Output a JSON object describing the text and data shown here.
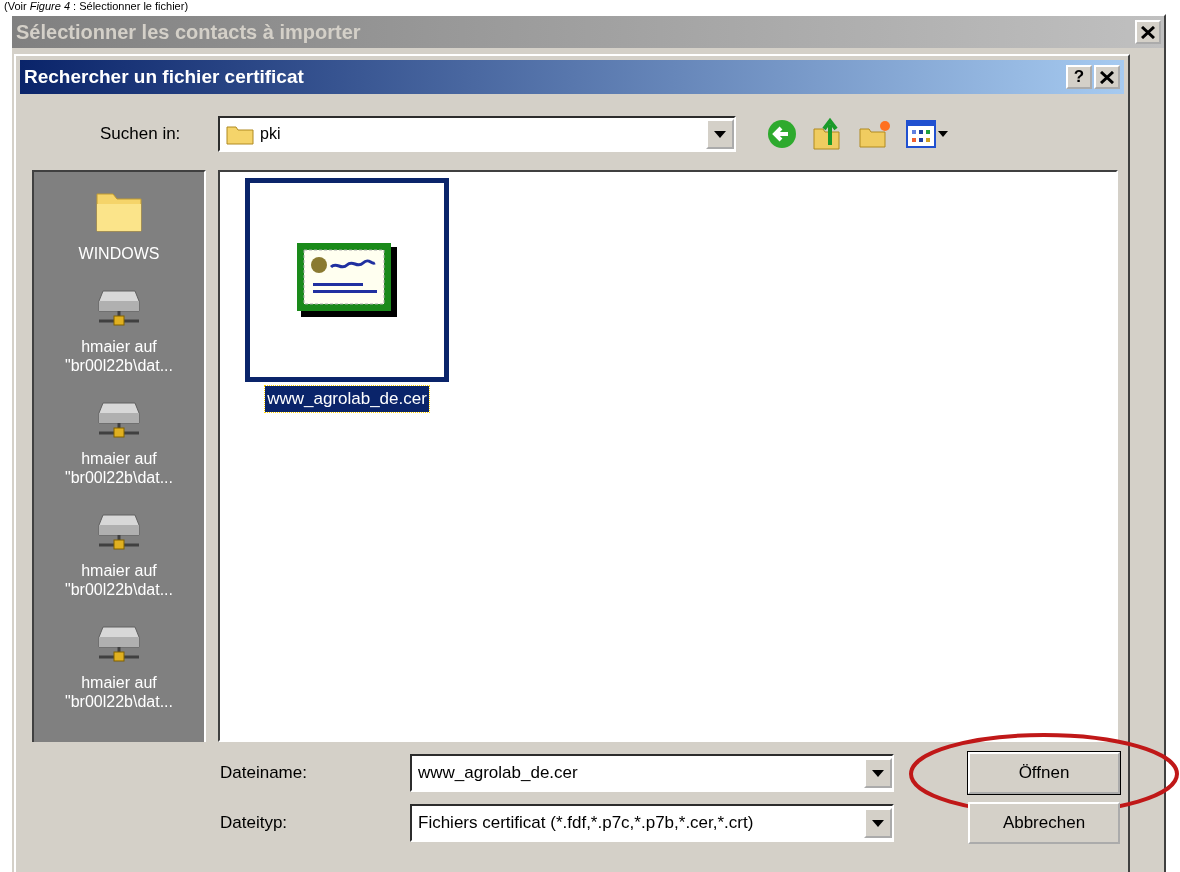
{
  "caption": "(Voir *Figure 4* : Sélectionner le fichier)",
  "outer_window": {
    "title": "Sélectionner les contacts à importer",
    "active": false
  },
  "dialog": {
    "title": "Rechercher un fichier certificat",
    "help_button": "?",
    "active": true
  },
  "look_in": {
    "label": "Suchen in:",
    "value": "pki"
  },
  "places": [
    {
      "label": "WINDOWS",
      "kind": "folder"
    },
    {
      "label": "hmaier auf\n\"br00l22b\\dat...",
      "kind": "network"
    },
    {
      "label": "hmaier auf\n\"br00l22b\\dat...",
      "kind": "network"
    },
    {
      "label": "hmaier auf\n\"br00l22b\\dat...",
      "kind": "network"
    },
    {
      "label": "hmaier auf\n\"br00l22b\\dat...",
      "kind": "network"
    }
  ],
  "files": [
    {
      "name": "www_agrolab_de.cer",
      "selected": true
    }
  ],
  "file_name": {
    "label": "Dateiname:",
    "value": "www_agrolab_de.cer"
  },
  "file_type": {
    "label": "Dateityp:",
    "value": "Fichiers certificat  (*.fdf,*.p7c,*.p7b,*.cer,*.crt)"
  },
  "buttons": [
    {
      "label": "Öffnen",
      "default": true,
      "circled": true
    },
    {
      "label": "Abbrechen",
      "default": false,
      "circled": false
    }
  ]
}
